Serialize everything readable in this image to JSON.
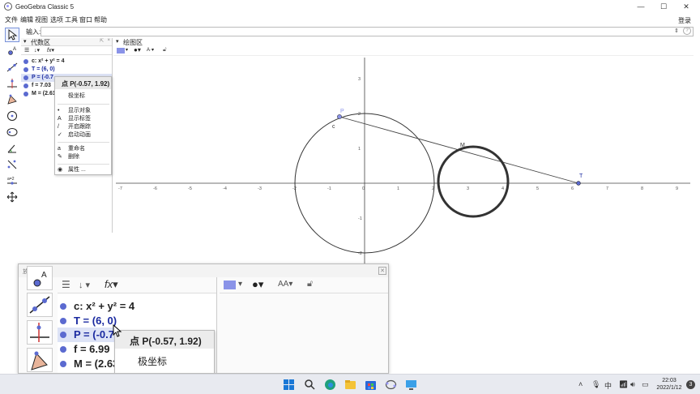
{
  "window": {
    "title": "GeoGebra Classic 5",
    "minimize": "—",
    "maximize": "☐",
    "close": "✕"
  },
  "menu": {
    "items": [
      "文件",
      "编辑",
      "视图",
      "选项",
      "工具",
      "窗口",
      "帮助"
    ],
    "login": "登录"
  },
  "input_bar": {
    "label": "输入:",
    "value": "",
    "help": "?"
  },
  "algebra": {
    "title": "代数区",
    "rows": [
      {
        "text": "c: x² + y² = 4",
        "style": "dark"
      },
      {
        "text": "T = (6, 0)",
        "style": "blue"
      },
      {
        "text": "P = (-0.7",
        "style": "blue",
        "selected": true
      },
      {
        "text": "f = 7.03",
        "style": "dark"
      },
      {
        "text": "M = (2.61",
        "style": "dark"
      }
    ]
  },
  "context_menu": {
    "header": "点 P(-0.57, 1.92)",
    "items": [
      {
        "label": "极坐标",
        "icon": ""
      },
      {
        "label": "显示对象",
        "icon": "•"
      },
      {
        "label": "显示标签",
        "icon": "A"
      },
      {
        "label": "开启跟踪",
        "icon": "/"
      },
      {
        "label": "启动动画",
        "icon": "✓"
      },
      {
        "label": "重命名",
        "icon": "a"
      },
      {
        "label": "删除",
        "icon": "✎"
      },
      {
        "label": "属性 ...",
        "icon": "◉"
      }
    ]
  },
  "graphics": {
    "title": "绘图区",
    "x_ticks": [
      "-7",
      "-6",
      "-5",
      "-4",
      "-3",
      "-2",
      "-1",
      "0",
      "1",
      "2",
      "3",
      "4",
      "5",
      "6",
      "7",
      "8",
      "9"
    ],
    "y_ticks": [
      "3",
      "2",
      "1",
      "-1",
      "-2"
    ],
    "labels": {
      "point_p": "P",
      "circle_c": "c",
      "point_m": "M",
      "point_t": "T"
    }
  },
  "magnifier": {
    "title": "放大镜",
    "close": "✕",
    "rows": [
      {
        "text": "c: x² + y² = 4",
        "style": "dark"
      },
      {
        "text": "T = (6, 0)",
        "style": "blue"
      },
      {
        "text": "P = (-0.7",
        "style": "blue",
        "selected": true
      },
      {
        "text": "f = 6.99",
        "style": "dark"
      },
      {
        "text": "M = (2.63",
        "style": "dark"
      }
    ],
    "ctx_header": "点 P(-0.57, 1.92)",
    "ctx_item": "极坐标"
  },
  "taskbar": {
    "time": "22:03",
    "date": "2022/1/12",
    "ime": "中",
    "notif": "3"
  },
  "colors": {
    "point": "#5b6ad0",
    "accent": "#1a2aa0",
    "curve": "#333333"
  }
}
